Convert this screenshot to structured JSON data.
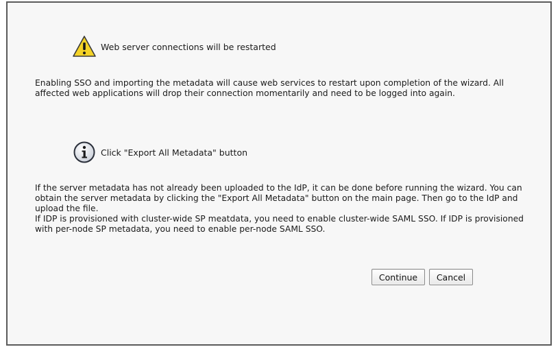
{
  "warning": {
    "icon": "warning-triangle-icon",
    "heading": "Web server connections will be restarted",
    "body": "Enabling SSO and importing the metadata will cause web services to restart upon completion of the wizard. All affected web applications will drop their connection momentarily and need to be logged into again."
  },
  "info": {
    "icon": "info-icon",
    "heading": "Click \"Export All Metadata\" button",
    "body_line1": "If the server metadata has not already been uploaded to the IdP, it can be done before running the wizard. You can obtain the server metadata by clicking the \"Export All Metadata\" button on the main page. Then go to the IdP and upload the file.",
    "body_line2": "If IDP is provisioned with cluster-wide SP meatdata, you need to enable cluster-wide SAML SSO. If IDP is provisioned with per-node SP metadata, you need to enable per-node SAML SSO."
  },
  "buttons": {
    "continue_label": "Continue",
    "cancel_label": "Cancel"
  },
  "colors": {
    "warning_fill": "#f5d327",
    "info_fill": "#dfe3ea",
    "dialog_border": "#5a5a5a"
  }
}
